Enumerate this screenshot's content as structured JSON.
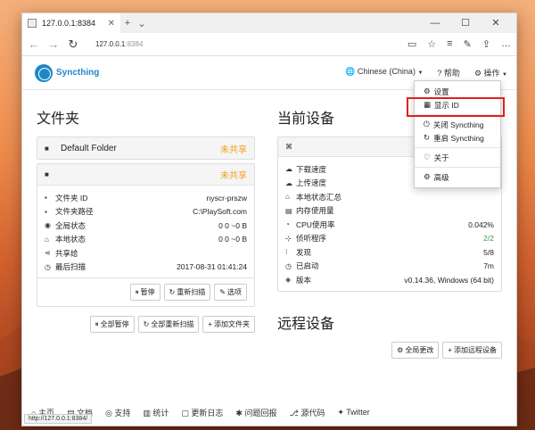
{
  "browser": {
    "tab_title": "127.0.0.1:8384",
    "address": "127.0.0.1",
    "address_port": ":8384"
  },
  "navbar": {
    "brand": "Syncthing",
    "language": "Chinese (China)",
    "help": "帮助",
    "actions": "操作"
  },
  "menu": {
    "items": [
      "设置",
      "显示 ID",
      "关闭 Syncthing",
      "重启 Syncthing",
      "关于",
      "高级"
    ]
  },
  "folders": {
    "heading": "文件夹",
    "default_folder": "Default Folder",
    "unshared": "未共享",
    "unshared2": "未共享",
    "rows": [
      {
        "label": "文件夹 ID",
        "value": "nyscr-prszw"
      },
      {
        "label": "文件夹路径",
        "value": "C:\\PlaySoft.com"
      },
      {
        "label": "全局状态",
        "value": "0  0  ~0 B"
      },
      {
        "label": "本地状态",
        "value": "0  0  ~0 B"
      },
      {
        "label": "共享给",
        "value": ""
      },
      {
        "label": "最后扫描",
        "value": "2017-08-31 01:41:24"
      }
    ],
    "btn_pause": "暂停",
    "btn_rescan": "重新扫描",
    "btn_options": "选项",
    "btn_pause_all": "全部暂停",
    "btn_rescan_all": "全部重新扫描",
    "btn_add_folder": "添加文件夹"
  },
  "device": {
    "heading": "当前设备",
    "rows": [
      {
        "label": "下载速度",
        "value": ""
      },
      {
        "label": "上传速度",
        "value": ""
      },
      {
        "label": "本地状态汇总",
        "value": ""
      },
      {
        "label": "内存使用量",
        "value": ""
      },
      {
        "label": "CPU使用率",
        "value": "0.042%"
      },
      {
        "label": "侦听程序",
        "value": "2/2"
      },
      {
        "label": "发现",
        "value": "5/8"
      },
      {
        "label": "已启动",
        "value": "7m"
      },
      {
        "label": "版本",
        "value": "v0.14.36, Windows (64 bit)"
      }
    ]
  },
  "remote": {
    "heading": "远程设备",
    "btn_change_all": "全局更改",
    "btn_add_device": "添加远程设备"
  },
  "footer": {
    "items": [
      "主页",
      "文档",
      "支持",
      "统计",
      "更新日志",
      "问题回报",
      "源代码",
      "Twitter"
    ],
    "status_url": "http://127.0.0.1:8384/"
  }
}
